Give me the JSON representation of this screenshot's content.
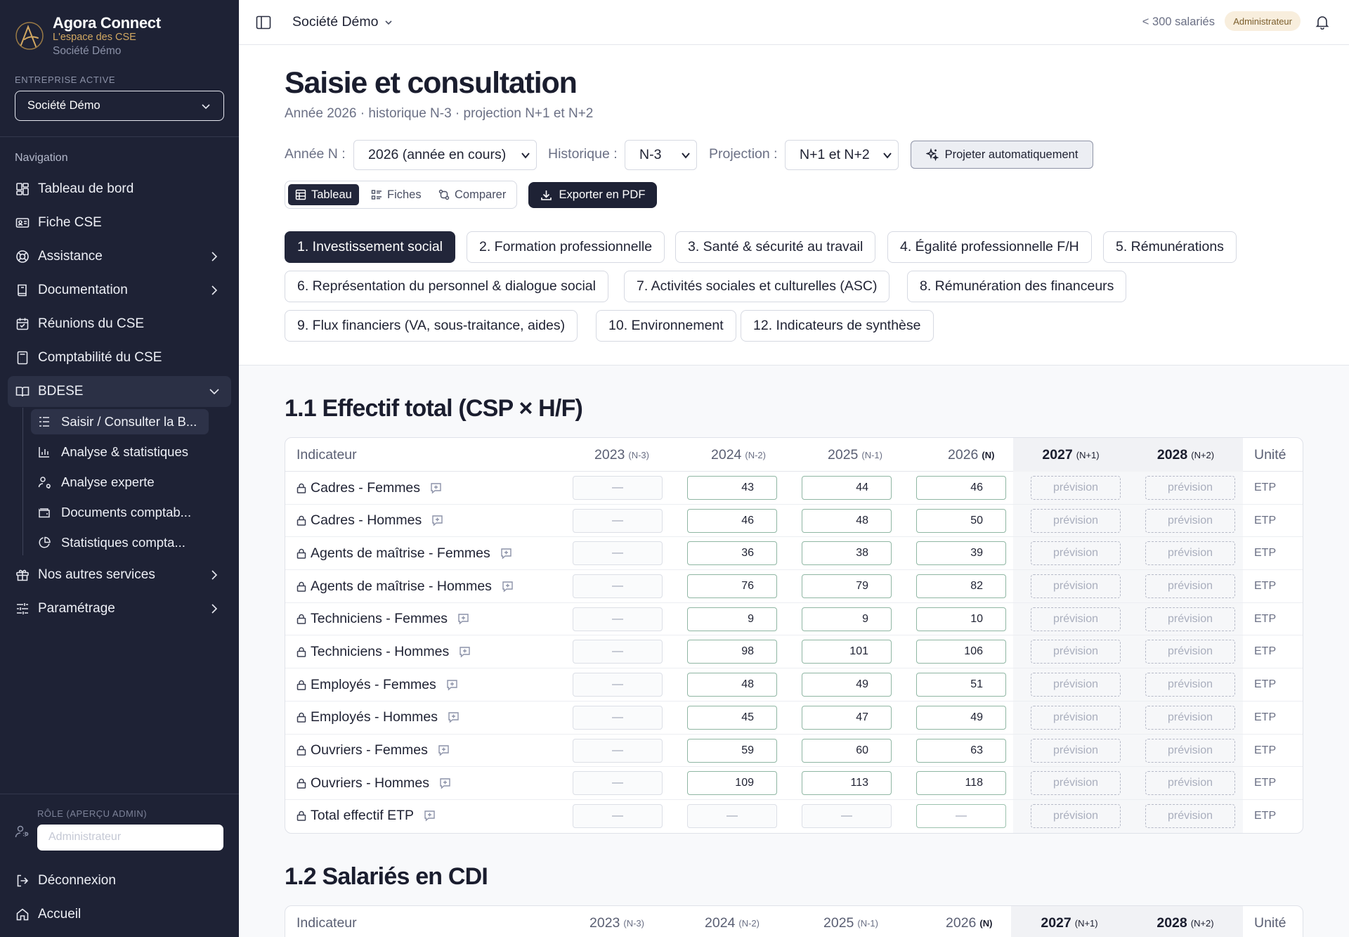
{
  "app": {
    "name": "Agora Connect",
    "tagline": "L'espace des CSE",
    "company": "Société Démo"
  },
  "sidebar": {
    "active_company_label": "ENTREPRISE ACTIVE",
    "active_company_value": "Société Démo",
    "nav_heading": "Navigation",
    "items": [
      {
        "label": "Tableau de bord",
        "icon": "dashboard-icon"
      },
      {
        "label": "Fiche CSE",
        "icon": "id-card-icon"
      },
      {
        "label": "Assistance",
        "icon": "lifebuoy-icon"
      },
      {
        "label": "Documentation",
        "icon": "book-icon"
      },
      {
        "label": "Réunions du CSE",
        "icon": "calendar-icon"
      },
      {
        "label": "Comptabilité du CSE",
        "icon": "calculator-icon"
      },
      {
        "label": "BDESE",
        "icon": "open-book-icon"
      },
      {
        "label": "Nos autres services",
        "icon": "gift-icon"
      },
      {
        "label": "Paramétrage",
        "icon": "sliders-icon"
      }
    ],
    "bdese_sub": [
      {
        "label": "Saisir / Consulter la B...",
        "icon": "list-icon"
      },
      {
        "label": "Analyse & statistiques",
        "icon": "bar-chart-icon"
      },
      {
        "label": "Analyse experte",
        "icon": "user-search-icon"
      },
      {
        "label": "Documents comptab...",
        "icon": "wallet-icon"
      },
      {
        "label": "Statistiques compta...",
        "icon": "pie-chart-icon"
      }
    ],
    "role_label": "RÔLE (APERÇU ADMIN)",
    "role_value": "Administrateur",
    "logout": "Déconnexion",
    "home": "Accueil"
  },
  "topbar": {
    "company": "Société Démo",
    "employees": "< 300 salariés",
    "role_badge": "Administrateur"
  },
  "header": {
    "title": "Saisie et consultation",
    "subtitle": "Année 2026 · historique N-3 · projection N+1 et N+2",
    "year_label": "Année N :",
    "year_value": "2026 (année en cours)",
    "history_label": "Historique :",
    "history_value": "N-3",
    "projection_label": "Projection :",
    "projection_value": "N+1 et N+2",
    "auto_project": "Projeter automatiquement",
    "views": [
      "Tableau",
      "Fiches",
      "Comparer"
    ],
    "export": "Exporter en PDF"
  },
  "themes": [
    "1. Investissement social",
    "2. Formation professionnelle",
    "3. Santé & sécurité au travail",
    "4. Égalité professionnelle F/H",
    "5. Rémunérations",
    "6. Représentation du personnel & dialogue social",
    "7. Activités sociales et culturelles (ASC)",
    "8. Rémunération des financeurs",
    "9. Flux financiers (VA, sous-traitance, aides)",
    "10. Environnement",
    "12. Indicateurs de synthèse"
  ],
  "table_headers": {
    "indicator": "Indicateur",
    "unit": "Unité",
    "years": [
      {
        "year": "2023",
        "tag": "(N-3)"
      },
      {
        "year": "2024",
        "tag": "(N-2)"
      },
      {
        "year": "2025",
        "tag": "(N-1)"
      },
      {
        "year": "2026",
        "tag": "(N)"
      },
      {
        "year": "2027",
        "tag": "(N+1)"
      },
      {
        "year": "2028",
        "tag": "(N+2)"
      }
    ]
  },
  "sections": [
    {
      "title": "1.1 Effectif total (CSP × H/F)",
      "rows": [
        {
          "label": "Cadres - Femmes",
          "values": [
            "—",
            "43",
            "44",
            "46"
          ],
          "unit": "ETP"
        },
        {
          "label": "Cadres - Hommes",
          "values": [
            "—",
            "46",
            "48",
            "50"
          ],
          "unit": "ETP"
        },
        {
          "label": "Agents de maîtrise - Femmes",
          "values": [
            "—",
            "36",
            "38",
            "39"
          ],
          "unit": "ETP"
        },
        {
          "label": "Agents de maîtrise - Hommes",
          "values": [
            "—",
            "76",
            "79",
            "82"
          ],
          "unit": "ETP"
        },
        {
          "label": "Techniciens - Femmes",
          "values": [
            "—",
            "9",
            "9",
            "10"
          ],
          "unit": "ETP"
        },
        {
          "label": "Techniciens - Hommes",
          "values": [
            "—",
            "98",
            "101",
            "106"
          ],
          "unit": "ETP"
        },
        {
          "label": "Employés - Femmes",
          "values": [
            "—",
            "48",
            "49",
            "51"
          ],
          "unit": "ETP"
        },
        {
          "label": "Employés - Hommes",
          "values": [
            "—",
            "45",
            "47",
            "49"
          ],
          "unit": "ETP"
        },
        {
          "label": "Ouvriers - Femmes",
          "values": [
            "—",
            "59",
            "60",
            "63"
          ],
          "unit": "ETP"
        },
        {
          "label": "Ouvriers - Hommes",
          "values": [
            "—",
            "109",
            "113",
            "118"
          ],
          "unit": "ETP"
        },
        {
          "label": "Total effectif ETP",
          "values": [
            "—",
            "—",
            "—",
            "—"
          ],
          "unit": "ETP"
        }
      ],
      "forecast_placeholder": "prévision"
    },
    {
      "title": "1.2 Salariés en CDI"
    }
  ],
  "colors": {
    "sidebar_bg": "#1e2235",
    "accent_gold": "#d2a862",
    "active_chip": "#22263a",
    "valid_border": "#8fb6a3"
  }
}
